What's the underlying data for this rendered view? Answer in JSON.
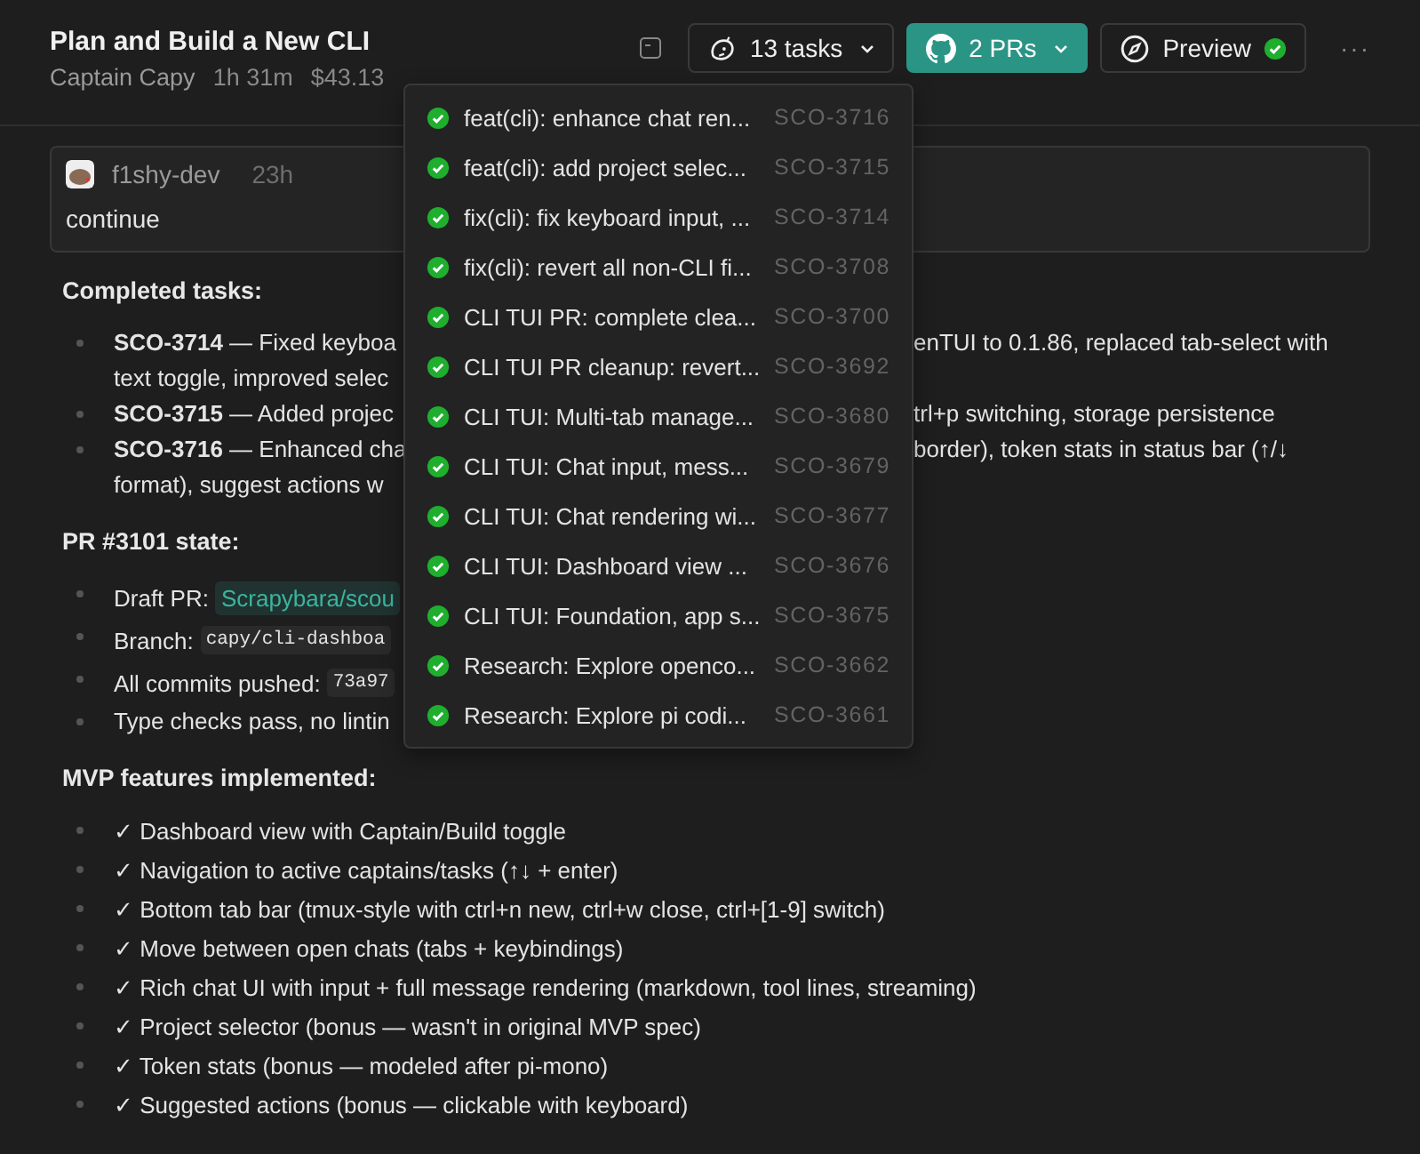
{
  "header": {
    "title": "Plan and Build a New CLI",
    "captain": "Captain Capy",
    "duration": "1h 31m",
    "cost": "$43.13",
    "tasks_button": {
      "label": "13 tasks"
    },
    "prs_button": {
      "label": "2 PRs"
    },
    "preview_button": {
      "label": "Preview",
      "done": true
    },
    "more_label": "···"
  },
  "task_menu": [
    {
      "title": "feat(cli): enhance chat ren...",
      "id": "SCO-3716",
      "done": true
    },
    {
      "title": "feat(cli): add project selec...",
      "id": "SCO-3715",
      "done": true
    },
    {
      "title": "fix(cli): fix keyboard input, ...",
      "id": "SCO-3714",
      "done": true
    },
    {
      "title": "fix(cli): revert all non-CLI fi...",
      "id": "SCO-3708",
      "done": true
    },
    {
      "title": "CLI TUI PR: complete clea...",
      "id": "SCO-3700",
      "done": true
    },
    {
      "title": "CLI TUI PR cleanup: revert...",
      "id": "SCO-3692",
      "done": true
    },
    {
      "title": "CLI TUI: Multi-tab manage...",
      "id": "SCO-3680",
      "done": true
    },
    {
      "title": "CLI TUI: Chat input, mess...",
      "id": "SCO-3679",
      "done": true
    },
    {
      "title": "CLI TUI: Chat rendering wi...",
      "id": "SCO-3677",
      "done": true
    },
    {
      "title": "CLI TUI: Dashboard view ...",
      "id": "SCO-3676",
      "done": true
    },
    {
      "title": "CLI TUI: Foundation, app s...",
      "id": "SCO-3675",
      "done": true
    },
    {
      "title": "Research: Explore openco...",
      "id": "SCO-3662",
      "done": true
    },
    {
      "title": "Research: Explore pi codi...",
      "id": "SCO-3661",
      "done": true
    }
  ],
  "message": {
    "author": "f1shy-dev",
    "time": "23h",
    "text": "continue"
  },
  "sections": [
    {
      "heading": "Completed tasks:",
      "items": [
        {
          "kind": "split",
          "lines": [
            {
              "left": "**SCO-3714** — Fixed keyboa",
              "right": "enTUI to 0.1.86, replaced tab-select with"
            },
            {
              "left": "text toggle, improved selec"
            }
          ]
        },
        {
          "kind": "split",
          "lines": [
            {
              "left": "**SCO-3715** — Added projec",
              "right": "trl+p switching, storage persistence"
            }
          ]
        },
        {
          "kind": "split",
          "lines": [
            {
              "left": "**SCO-3716** — Enhanced cha",
              "right": "border), token stats in status bar (↑/↓"
            },
            {
              "left": "format), suggest actions w"
            }
          ]
        }
      ]
    },
    {
      "heading": "PR #3101 state:",
      "items": [
        {
          "kind": "code",
          "label": "Draft PR:",
          "code": "Scrapybara/scou",
          "link": true
        },
        {
          "kind": "code",
          "label": "Branch:",
          "code": "capy/cli-dashboa",
          "link": false
        },
        {
          "kind": "code",
          "label": "All commits pushed:",
          "code": "73a97",
          "link": false
        },
        {
          "kind": "split",
          "lines": [
            {
              "left": "Type checks pass, no lintin"
            }
          ]
        }
      ]
    },
    {
      "heading": "MVP features implemented:",
      "items": [
        {
          "kind": "text",
          "text": "✓ Dashboard view with Captain/Build toggle"
        },
        {
          "kind": "text",
          "text": "✓ Navigation to active captains/tasks (↑↓ + enter)"
        },
        {
          "kind": "text",
          "text": "✓ Bottom tab bar (tmux-style with ctrl+n new, ctrl+w close, ctrl+[1-9] switch)"
        },
        {
          "kind": "text",
          "text": "✓ Move between open chats (tabs + keybindings)"
        },
        {
          "kind": "text",
          "text": "✓ Rich chat UI with input + full message rendering (markdown, tool lines, streaming)"
        },
        {
          "kind": "text",
          "text": "✓ Project selector (bonus — wasn't in original MVP spec)"
        },
        {
          "kind": "text",
          "text": "✓ Token stats (bonus — modeled after pi-mono)"
        },
        {
          "kind": "text",
          "text": "✓ Suggested actions (bonus — clickable with keyboard)"
        }
      ]
    }
  ]
}
